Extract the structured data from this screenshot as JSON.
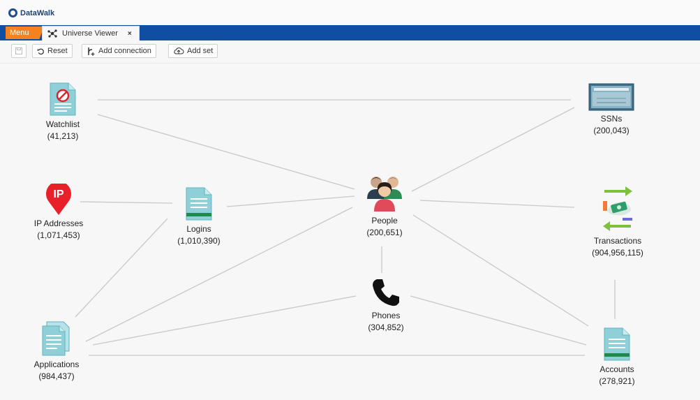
{
  "app": {
    "name": "DataWalk"
  },
  "tabbar": {
    "menu_label": "Menu",
    "tab_label": "Universe Viewer",
    "tab_close": "×"
  },
  "toolbar": {
    "reset_label": "Reset",
    "add_connection_label": "Add connection",
    "add_set_label": "Add set"
  },
  "nodes": {
    "watchlist": {
      "label": "Watchlist",
      "count": "(41,213)"
    },
    "ssns": {
      "label": "SSNs",
      "count": "(200,043)"
    },
    "ip_addresses": {
      "label": "IP Addresses",
      "count": "(1,071,453)",
      "icon_text": "IP"
    },
    "logins": {
      "label": "Logins",
      "count": "(1,010,390)"
    },
    "people": {
      "label": "People",
      "count": "(200,651)"
    },
    "transactions": {
      "label": "Transactions",
      "count": "(904,956,115)"
    },
    "phones": {
      "label": "Phones",
      "count": "(304,852)"
    },
    "applications": {
      "label": "Applications",
      "count": "(984,437)"
    },
    "accounts": {
      "label": "Accounts",
      "count": "(278,921)"
    }
  },
  "colors": {
    "tab_bar": "#0f4ea3",
    "menu": "#f5821f",
    "doc_teal": "#8fd0d8",
    "doc_green": "#1f8a4c",
    "ip_red": "#e8202a",
    "edge": "#c8c8c8"
  }
}
